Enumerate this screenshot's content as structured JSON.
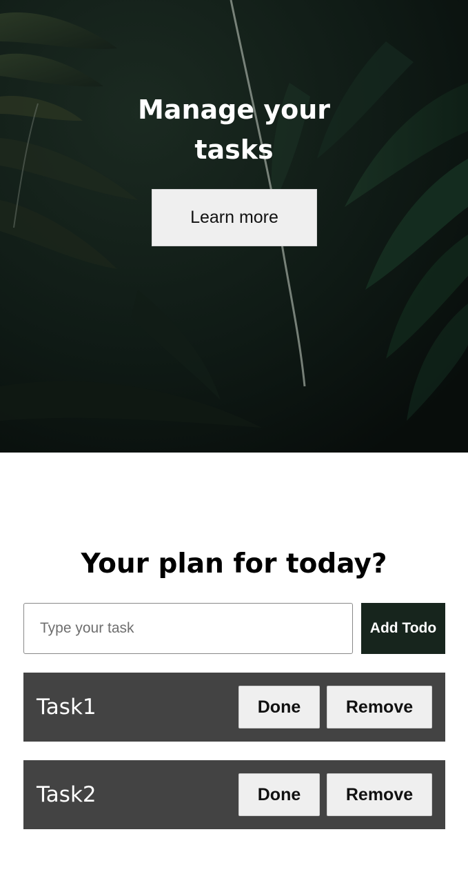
{
  "hero": {
    "title_line1": "Manage your",
    "title_line2": "tasks",
    "learn_more_label": "Learn more"
  },
  "planner": {
    "heading": "Your plan for today?",
    "input_placeholder": "Type your task",
    "input_value": "",
    "add_button_label": "Add Todo"
  },
  "todos": [
    {
      "label": "Task1",
      "done_label": "Done",
      "remove_label": "Remove"
    },
    {
      "label": "Task2",
      "done_label": "Done",
      "remove_label": "Remove"
    }
  ],
  "colors": {
    "hero_dark": "#0d1512",
    "add_button_bg": "#17251d",
    "todo_row_bg": "#434343",
    "button_light": "#efefef"
  }
}
